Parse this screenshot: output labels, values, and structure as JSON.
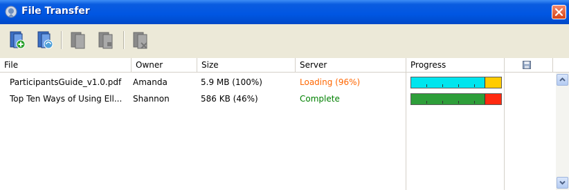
{
  "window": {
    "title": "File Transfer"
  },
  "toolbar": {
    "buttons": [
      {
        "name": "add-file",
        "enabled": true
      },
      {
        "name": "send-file",
        "enabled": true
      },
      {
        "name": "copy-file",
        "enabled": false
      },
      {
        "name": "paste-file",
        "enabled": false
      },
      {
        "name": "remove-file",
        "enabled": false
      }
    ]
  },
  "columns": {
    "file": "File",
    "owner": "Owner",
    "size": "Size",
    "server": "Server",
    "progress": "Progress",
    "save_icon": "save-icon"
  },
  "rows": [
    {
      "file": "ParticipantsGuide_v1.0.pdf",
      "owner": "Amanda",
      "size": "5.9 MB (100%)",
      "server": "Loading (96%)",
      "server_color": "#ff6600",
      "progress": {
        "fraction": 0.82,
        "fill_color": "#00e5ee",
        "tail_color": "#ffcc00"
      }
    },
    {
      "file": "Top Ten Ways of Using Ell...",
      "owner": "Shannon",
      "size": "586 KB (46%)",
      "server": "Complete",
      "server_color": "#008000",
      "progress": {
        "fraction": 0.82,
        "fill_color": "#2e9e3a",
        "tail_color": "#ff2a10"
      }
    }
  ]
}
